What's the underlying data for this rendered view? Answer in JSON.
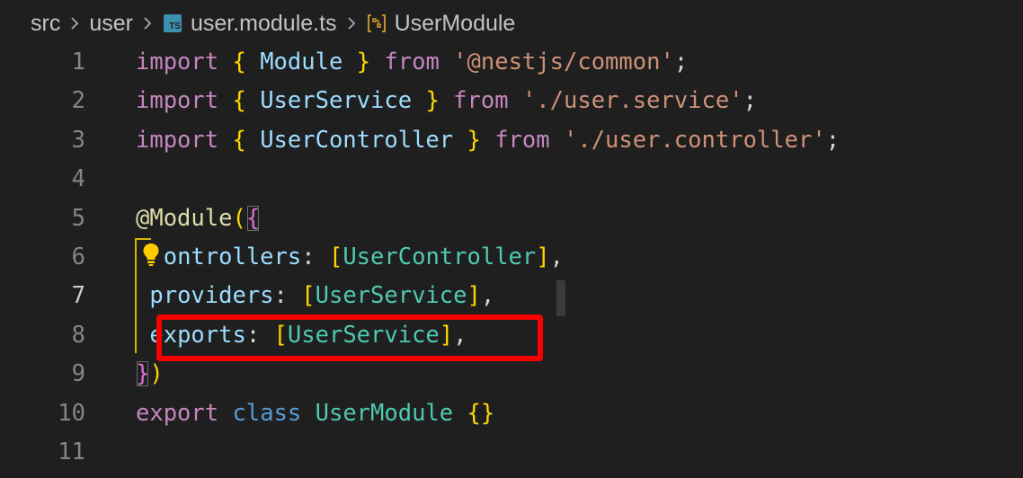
{
  "breadcrumb": {
    "items": [
      {
        "label": "src"
      },
      {
        "label": "user"
      },
      {
        "label": "user.module.ts",
        "icon": "typescript-file-icon",
        "icon_text": "TS"
      },
      {
        "label": "UserModule",
        "icon": "module-symbol-icon"
      }
    ]
  },
  "editor": {
    "active_line": "7",
    "lines": [
      {
        "number": "1",
        "tokens": [
          {
            "t": "import",
            "c": "kw-import"
          },
          {
            "t": " ",
            "c": "plain"
          },
          {
            "t": "{",
            "c": "brace1"
          },
          {
            "t": " Module ",
            "c": "ident"
          },
          {
            "t": "}",
            "c": "brace1"
          },
          {
            "t": " ",
            "c": "plain"
          },
          {
            "t": "from",
            "c": "kw-import"
          },
          {
            "t": " ",
            "c": "plain"
          },
          {
            "t": "'@nestjs/common'",
            "c": "str"
          },
          {
            "t": ";",
            "c": "plain"
          }
        ]
      },
      {
        "number": "2",
        "tokens": [
          {
            "t": "import",
            "c": "kw-import"
          },
          {
            "t": " ",
            "c": "plain"
          },
          {
            "t": "{",
            "c": "brace1"
          },
          {
            "t": " UserService ",
            "c": "ident"
          },
          {
            "t": "}",
            "c": "brace1"
          },
          {
            "t": " ",
            "c": "plain"
          },
          {
            "t": "from",
            "c": "kw-import"
          },
          {
            "t": " ",
            "c": "plain"
          },
          {
            "t": "'./user.service'",
            "c": "str"
          },
          {
            "t": ";",
            "c": "plain"
          }
        ]
      },
      {
        "number": "3",
        "tokens": [
          {
            "t": "import",
            "c": "kw-import"
          },
          {
            "t": " ",
            "c": "plain"
          },
          {
            "t": "{",
            "c": "brace1"
          },
          {
            "t": " UserController ",
            "c": "ident"
          },
          {
            "t": "}",
            "c": "brace1"
          },
          {
            "t": " ",
            "c": "plain"
          },
          {
            "t": "from",
            "c": "kw-import"
          },
          {
            "t": " ",
            "c": "plain"
          },
          {
            "t": "'./user.controller'",
            "c": "str"
          },
          {
            "t": ";",
            "c": "plain"
          }
        ]
      },
      {
        "number": "4",
        "tokens": []
      },
      {
        "number": "5",
        "tokens": [
          {
            "t": "@Module",
            "c": "fn"
          },
          {
            "t": "(",
            "c": "brace1"
          },
          {
            "t": "{",
            "c": "brace2",
            "match": true
          }
        ]
      },
      {
        "number": "6",
        "tokens": [
          {
            "t": " ",
            "c": "plain"
          },
          {
            "t": "controllers",
            "c": "ident"
          },
          {
            "t": ": ",
            "c": "plain"
          },
          {
            "t": "[",
            "c": "brace1"
          },
          {
            "t": "UserController",
            "c": "cls"
          },
          {
            "t": "]",
            "c": "brace1"
          },
          {
            "t": ",",
            "c": "plain"
          }
        ]
      },
      {
        "number": "7",
        "tokens": [
          {
            "t": " ",
            "c": "plain"
          },
          {
            "t": "providers",
            "c": "ident"
          },
          {
            "t": ": ",
            "c": "plain"
          },
          {
            "t": "[",
            "c": "brace1"
          },
          {
            "t": "UserService",
            "c": "cls"
          },
          {
            "t": "]",
            "c": "brace1"
          },
          {
            "t": ",",
            "c": "plain"
          }
        ]
      },
      {
        "number": "8",
        "tokens": [
          {
            "t": " ",
            "c": "plain"
          },
          {
            "t": "exports",
            "c": "ident"
          },
          {
            "t": ": ",
            "c": "plain"
          },
          {
            "t": "[",
            "c": "brace1"
          },
          {
            "t": "UserService",
            "c": "cls"
          },
          {
            "t": "]",
            "c": "brace1"
          },
          {
            "t": ",",
            "c": "plain"
          }
        ]
      },
      {
        "number": "9",
        "tokens": [
          {
            "t": "}",
            "c": "brace2",
            "match": true
          },
          {
            "t": ")",
            "c": "brace1"
          }
        ]
      },
      {
        "number": "10",
        "tokens": [
          {
            "t": "export",
            "c": "kw-import"
          },
          {
            "t": " ",
            "c": "plain"
          },
          {
            "t": "class",
            "c": "kw-decl"
          },
          {
            "t": " ",
            "c": "plain"
          },
          {
            "t": "UserModule",
            "c": "cls"
          },
          {
            "t": " ",
            "c": "plain"
          },
          {
            "t": "{}",
            "c": "brace1"
          }
        ]
      },
      {
        "number": "11",
        "tokens": []
      }
    ]
  },
  "annotation": {
    "color": "#f60000",
    "target_line": "8"
  },
  "colors": {
    "background": "#1f1f1f",
    "keyword": "#c586c0",
    "identifier": "#9cdcfe",
    "string": "#ce9178",
    "class": "#4ec9b0",
    "bracket": "#ffd700"
  }
}
